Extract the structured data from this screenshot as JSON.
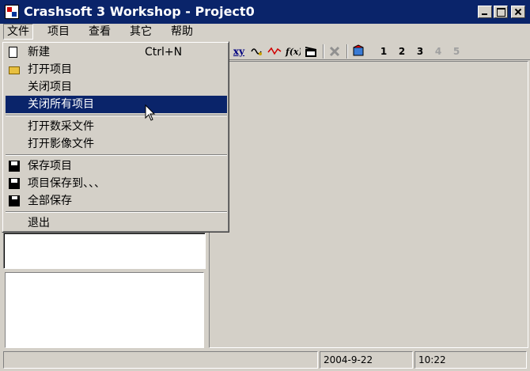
{
  "window": {
    "title": "Crashsoft 3 Workshop - Project0"
  },
  "menubar": {
    "file": "文件",
    "project": "项目",
    "view": "查看",
    "other": "其它",
    "help": "帮助"
  },
  "file_menu": {
    "new": "新建",
    "new_shortcut": "Ctrl+N",
    "open_project": "打开项目",
    "close_project": "关闭项目",
    "close_all_projects": "关闭所有项目",
    "open_data_file": "打开数采文件",
    "open_image_file": "打开影像文件",
    "save_project": "保存项目",
    "save_project_as": "项目保存到、、、",
    "save_all": "全部保存",
    "exit": "退出"
  },
  "toolbar": {
    "xy_label": "xy",
    "view_buttons": [
      "1",
      "2",
      "3",
      "4",
      "5"
    ]
  },
  "statusbar": {
    "main": "",
    "date": "2004-9-22",
    "time": "10:22"
  },
  "colors": {
    "titlebar": "#0a246a",
    "highlight": "#0a246a",
    "face": "#d4d0c8"
  }
}
